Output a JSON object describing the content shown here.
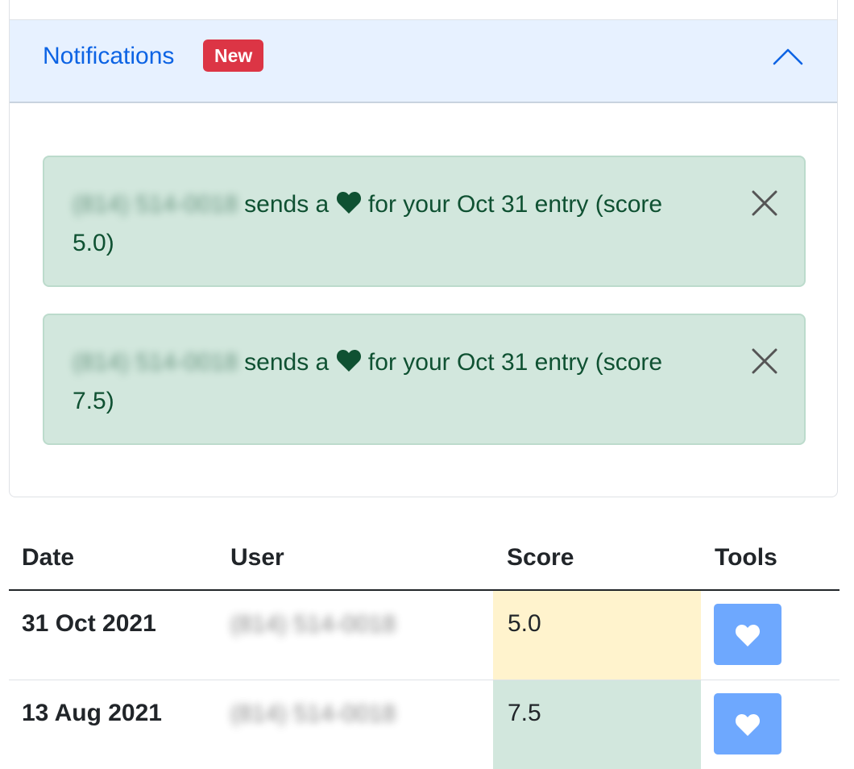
{
  "notifications": {
    "title": "Notifications",
    "badge": "New",
    "items": [
      {
        "user": "(814) 514-0018",
        "text_before": "sends a",
        "text_after": "for your Oct 31 entry (score 5.0)"
      },
      {
        "user": "(814) 514-0018",
        "text_before": "sends a",
        "text_after": "for your Oct 31 entry (score 7.5)"
      }
    ]
  },
  "table": {
    "headers": [
      "Date",
      "User",
      "Score",
      "Tools"
    ],
    "rows": [
      {
        "date": "31 Oct 2021",
        "user": "(814) 514-0018",
        "score": "5.0",
        "score_status": "warning"
      },
      {
        "date": "13 Aug 2021",
        "user": "(814) 514-0018",
        "score": "7.5",
        "score_status": "success"
      }
    ]
  },
  "icons": {
    "collapse": "chevron-up-icon",
    "dismiss": "close-icon",
    "heart": "heart-icon"
  },
  "colors": {
    "accent": "#0c63e4",
    "badge": "#dc3545",
    "alert_bg": "#d2e7dd",
    "alert_text": "#0f5132",
    "warning_bg": "#fff3cd",
    "button_bg": "#6ea8fe"
  }
}
